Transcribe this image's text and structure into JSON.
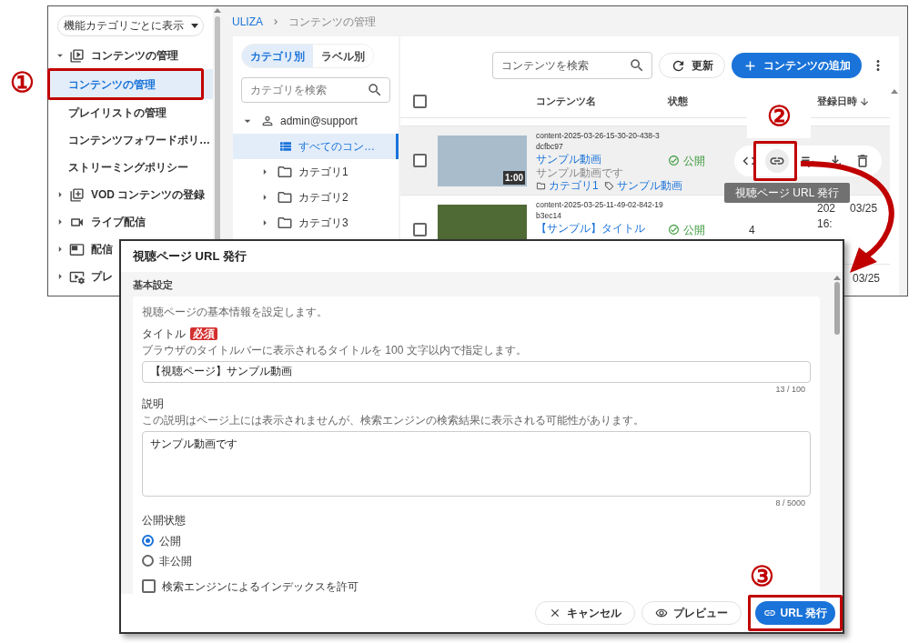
{
  "app": {
    "sidebar": {
      "view_select": "機能カテゴリごとに表示",
      "items": [
        {
          "label": "コンテンツの管理",
          "expanded": true,
          "children": [
            {
              "label": "コンテンツの管理",
              "selected": true,
              "callout": "①"
            },
            {
              "label": "プレイリストの管理",
              "selected": false
            },
            {
              "label": "コンテンツフォワードポリ…",
              "selected": false
            },
            {
              "label": "ストリーミングポリシー",
              "selected": false
            }
          ]
        },
        {
          "label": "VOD コンテンツの登録",
          "expanded": false
        },
        {
          "label": "ライブ配信",
          "expanded": false
        },
        {
          "label": "配信",
          "expanded": false
        },
        {
          "label": "プレ",
          "expanded": false
        }
      ]
    },
    "breadcrumb": [
      "ULIZA",
      "コンテンツの管理"
    ],
    "category_panel": {
      "tabs": [
        {
          "label": "カテゴリ別",
          "selected": true
        },
        {
          "label": "ラベル別",
          "selected": false
        }
      ],
      "search": {
        "placeholder": "カテゴリを検索"
      },
      "tree": [
        {
          "label": "admin@support",
          "expanded": true,
          "children": [
            {
              "label": "すべてのコン…",
              "selected": true
            },
            {
              "label": "カテゴリ1",
              "expanded": false,
              "selected": false
            },
            {
              "label": "カテゴリ2",
              "expanded": false,
              "selected": false
            },
            {
              "label": "カテゴリ3",
              "expanded": false,
              "selected": false
            }
          ]
        }
      ]
    },
    "toolbar": {
      "search": {
        "placeholder": "コンテンツを検索"
      },
      "refresh": "更新",
      "add": "コンテンツの追加"
    },
    "table": {
      "all_checked": false,
      "columns": [
        "コンテンツ名",
        "状態",
        "登録日時"
      ],
      "rows": [
        {
          "kind": "full",
          "checked": false,
          "hovered": true,
          "id": "content-2025-03-26-15-30-20-438-3dcfbc97",
          "title": "サンプル動画",
          "description": "サンプル動画です",
          "category": "カテゴリ1",
          "label": "サンプル動画",
          "duration": "1:00",
          "status": "公開",
          "actions": {
            "link_callout": "②",
            "tooltip": "視聴ページ URL 発行"
          }
        },
        {
          "kind": "full",
          "checked": false,
          "hovered": false,
          "id": "content-2025-03-25-11-49-02-842-19b3ec14",
          "title": "【サンプル】タイトル",
          "status": "公開",
          "column_4": "4",
          "date": "202",
          "date_2": "03/25",
          "time": "16:"
        },
        {
          "kind": "cut",
          "date": "03/25"
        }
      ]
    }
  },
  "dialog": {
    "title": "視聴ページ URL 発行",
    "section": "基本設定",
    "intro": "視聴ページの基本情報を設定します。",
    "title_field": {
      "label": "タイトル",
      "required": "必須",
      "hint": "ブラウザのタイトルバーに表示されるタイトルを 100 文字以内で指定します。",
      "value": "【視聴ページ】サンプル動画",
      "counter": "13 / 100"
    },
    "description_field": {
      "label": "説明",
      "hint": "この説明はページ上には表示されませんが、検索エンジンの検索結果に表示される可能性があります。",
      "value": "サンプル動画です",
      "counter": "8 / 5000"
    },
    "visibility": {
      "label": "公開状態",
      "options": [
        {
          "label": "公開",
          "selected": true
        },
        {
          "label": "非公開",
          "selected": false
        }
      ]
    },
    "index_checkbox": {
      "label": "検索エンジンによるインデックスを許可",
      "checked": false
    },
    "buttons": {
      "cancel": "キャンセル",
      "preview": "プレビュー",
      "issue": "URL 発行",
      "issue_callout": "③"
    }
  }
}
